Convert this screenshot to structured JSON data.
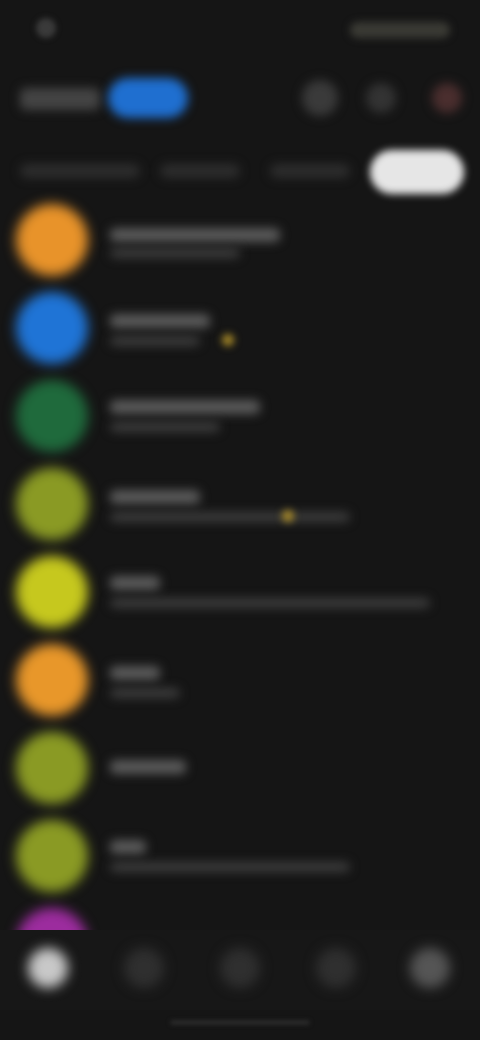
{
  "theme": {
    "background": "#151515",
    "accent": "#1f6fd0",
    "selected_chip": "#e6e6e6"
  },
  "status_bar": {
    "icons": [
      "status-icon",
      "battery-icon"
    ]
  },
  "top_bar": {
    "icons": [
      "filter-icon",
      "search-icon",
      "notification-icon"
    ]
  },
  "contacts": [
    {
      "avatar_color": "#e8932a"
    },
    {
      "avatar_color": "#1f74d6"
    },
    {
      "avatar_color": "#1f6a3c"
    },
    {
      "avatar_color": "#8a9a24"
    },
    {
      "avatar_color": "#c6c81e"
    },
    {
      "avatar_color": "#e8972a"
    },
    {
      "avatar_color": "#8a9a24"
    },
    {
      "avatar_color": "#8a9a24"
    },
    {
      "avatar_color": "#9c2c9e"
    }
  ],
  "bottom_nav": {
    "icons": [
      "home-icon",
      "chat-icon",
      "calls-icon",
      "people-icon",
      "profile-icon"
    ]
  }
}
